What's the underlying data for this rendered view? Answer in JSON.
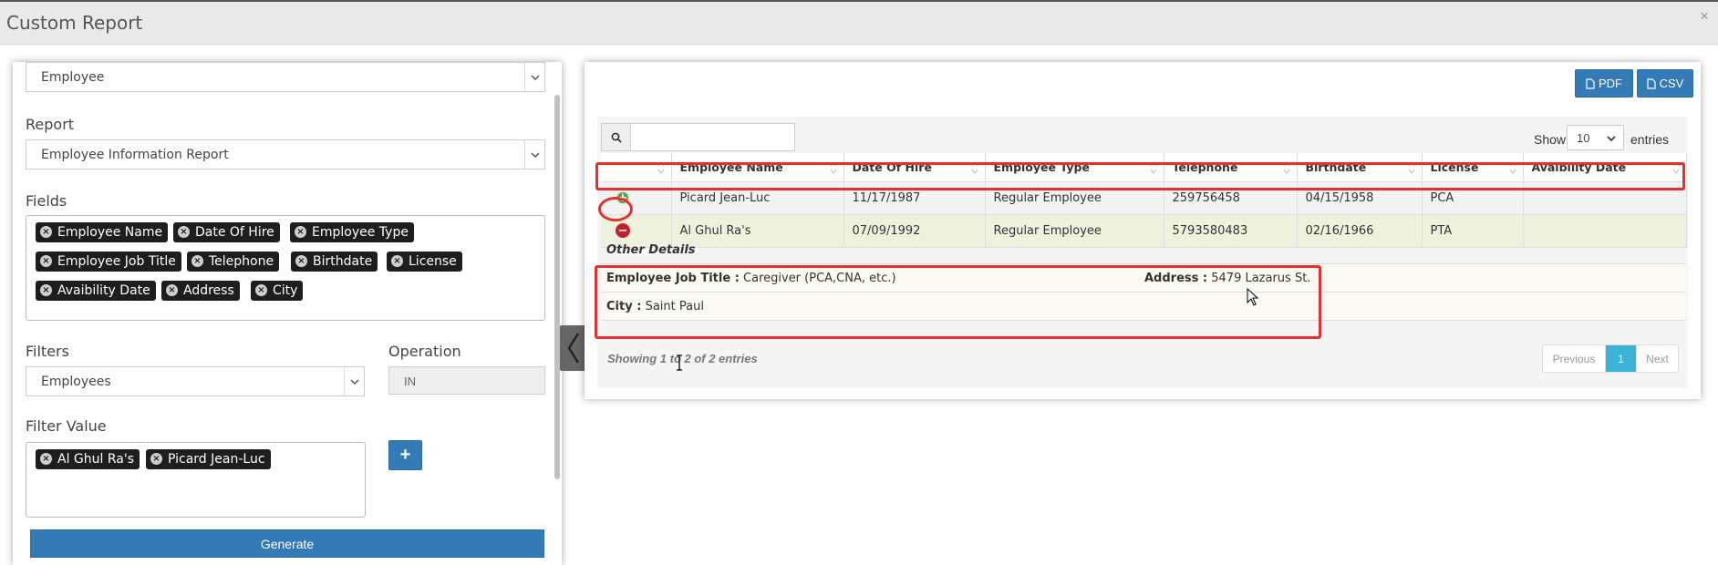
{
  "window": {
    "title": "Custom Report",
    "close_glyph": "×"
  },
  "left": {
    "category_select": "Employee",
    "report_label": "Report",
    "report_select": "Employee Information Report",
    "fields_label": "Fields",
    "fields": [
      "Employee Name",
      "Date Of Hire",
      "Employee Type",
      "Employee Job Title",
      "Telephone",
      "Birthdate",
      "License",
      "Avaibility Date",
      "Address",
      "City"
    ],
    "filters_label": "Filters",
    "filters_select": "Employees",
    "operation_label": "Operation",
    "operation_value": "IN",
    "filter_value_label": "Filter Value",
    "filter_values": [
      "Al Ghul Ra's",
      "Picard Jean-Luc"
    ],
    "add_button": "+",
    "generate_button": "Generate"
  },
  "right": {
    "pdf_button": "PDF",
    "csv_button": "CSV",
    "search_placeholder": "",
    "show_label": "Show",
    "show_value": "10",
    "entries_label": "entries",
    "columns": [
      "",
      "Employee Name",
      "Date Of Hire",
      "Employee Type",
      "Telephone",
      "Birthdate",
      "License",
      "Avaibility Date"
    ],
    "rows": [
      {
        "control": "+",
        "name": "Picard Jean-Luc",
        "hire": "11/17/1987",
        "type": "Regular Employee",
        "phone": "259756458",
        "birth": "04/15/1958",
        "license": "PCA",
        "avail": ""
      },
      {
        "control": "−",
        "name": "Al Ghul Ra's",
        "hire": "07/09/1992",
        "type": "Regular Employee",
        "phone": "5793580483",
        "birth": "02/16/1966",
        "license": "PTA",
        "avail": ""
      }
    ],
    "details": {
      "title": "Other Details",
      "job_title_label": "Employee Job Title :",
      "job_title_value": "Caregiver (PCA,CNA, etc.)",
      "address_label": "Address :",
      "address_value": "5479 Lazarus St.",
      "city_label": "City :",
      "city_value": "Saint Paul"
    },
    "info": "Showing 1 to 2 of 2 entries",
    "pager": {
      "prev": "Previous",
      "current": "1",
      "next": "Next"
    }
  },
  "colors": {
    "primary": "#337ab7",
    "highlight": "#e53030",
    "plus": "#5a9e4b",
    "minus": "#c0232a",
    "page_active": "#3cb2d6"
  }
}
